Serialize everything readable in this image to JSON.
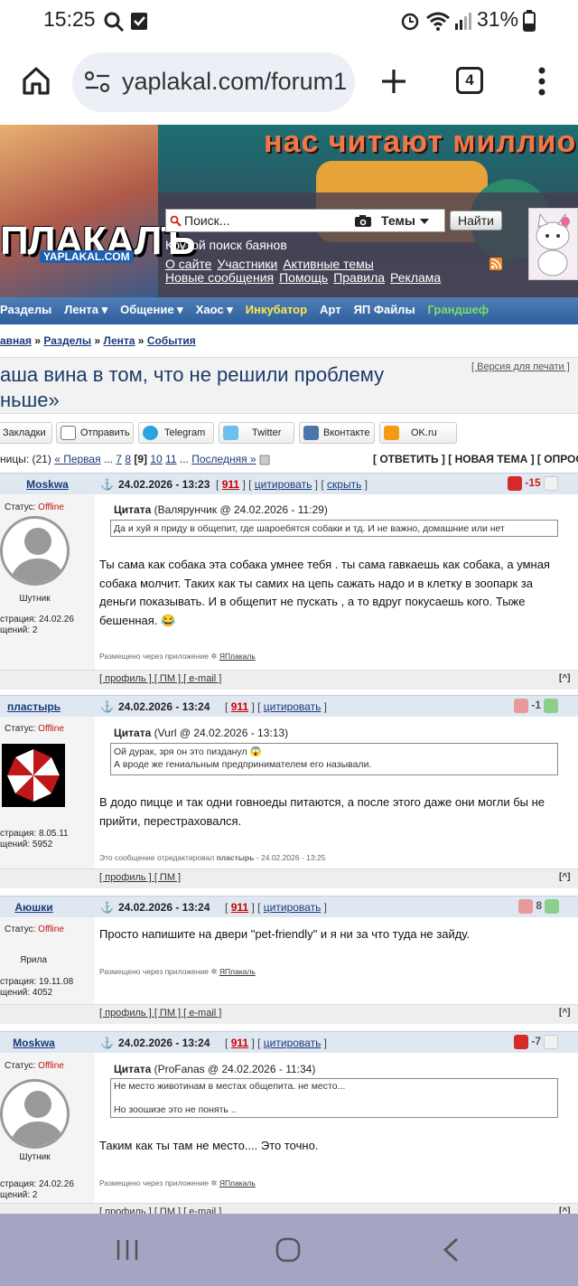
{
  "status": {
    "time": "15:25",
    "battery": "31%"
  },
  "browser": {
    "url": "yaplakal.com/forum1",
    "tab_count": "4"
  },
  "banner": {
    "slogan": "нас читают миллионы",
    "logo": "ПЛАКАЛЪ",
    "logo_sub": "YAPLAKAL.COM",
    "search_placeholder": "Поиск...",
    "search_scope": "Темы",
    "search_button": "Найти",
    "tagline": "Крутой поиск баянов",
    "links_row1": [
      "О сайте",
      "Участники",
      "Активные темы"
    ],
    "links_row2": [
      "Новые сообщения",
      "Помощь",
      "Правила",
      "Реклама"
    ]
  },
  "nav": [
    {
      "label": "Разделы",
      "color": "#ffffff"
    },
    {
      "label": "Лента ▾",
      "color": "#ffffff"
    },
    {
      "label": "Общение ▾",
      "color": "#ffffff"
    },
    {
      "label": "Хаос ▾",
      "color": "#ffffff"
    },
    {
      "label": "Инкубатор",
      "color": "#ffe64a"
    },
    {
      "label": "Арт",
      "color": "#ffffff"
    },
    {
      "label": "ЯП Файлы",
      "color": "#ffffff"
    },
    {
      "label": "Грандшеф",
      "color": "#7ddc6a"
    }
  ],
  "breadcrumb": {
    "home": "авная",
    "sep": "»",
    "sections": "Разделы",
    "feed": "Лента",
    "events": "События"
  },
  "topic": {
    "title_line1": "аша вина в том, что не решили проблему",
    "title_line2": "ньше»",
    "print_version": "[ Версия для печати ]"
  },
  "share": {
    "bookmarks": "Закладки",
    "send": "Отправить",
    "telegram": "Telegram",
    "twitter": "Twitter",
    "vk": "Вконтакте",
    "ok": "OK.ru"
  },
  "pagination": {
    "prefix": "ницы: (21)",
    "first": "« Первая",
    "dots1": "...",
    "p7": "7",
    "p8": "8",
    "current": "[9]",
    "p10": "10",
    "p11": "11",
    "dots2": "...",
    "last": "Последняя »",
    "actions": "[ ОТВЕТИТЬ ] [ НОВАЯ ТЕМА ] [ ОПРОС ]"
  },
  "posts": [
    {
      "author": "Moskwa",
      "date": "24.02.2026 - 13:23",
      "num": "911",
      "cite": "цитировать",
      "hide": "скрыть",
      "rating": "-15",
      "status_label": "Статус:",
      "status": "Offline",
      "rank": "Шутник",
      "reg": "страция: 24.02.26",
      "msgs": "щений: 2",
      "quote_head": "Цитата",
      "quote_src": "(Валярунчик @ 24.02.2026 - 11:29)",
      "quote_lines": [
        "Да и хуй я приду в общепит, где шароебятся собаки и тд. И не важно, домашние или нет"
      ],
      "text": "Ты сама как собака эта собака умнее тебя . ты сама гавкаешь как собака, а умная собака молчит. Таких как ты самих на цепь сажать надо и в клетку в зоопарк за деньги показывать. И в общепит не пускать , а то вдруг покусаешь кого. Тыже бешенная. 😂",
      "via": "Размещено через приложение",
      "app": "ЯПлакаль",
      "footer": "[ профиль ] [ ПМ ] [ e-mail ]"
    },
    {
      "author": "пластырь",
      "date": "24.02.2026 - 13:24",
      "num": "911",
      "cite": "цитировать",
      "rating": "-1",
      "status_label": "Статус:",
      "status": "Offline",
      "reg": "страция: 8.05.11",
      "msgs": "щений: 5952",
      "quote_head": "Цитата",
      "quote_src": "(Vurl @ 24.02.2026 - 13:13)",
      "quote_lines": [
        "Ой дурак, зря он это пизданул 😱",
        "А вроде же гениальным предпринимателем его называли."
      ],
      "text": "В додо пицце и так одни говноеды питаются, а после этого даже они могли бы не прийти, перестраховался.",
      "edited": "Это сообщение отредактировал",
      "edited_by": "пластырь",
      "edited_date": "- 24.02.2026 - 13:25",
      "footer": "[ профиль ] [ ПМ ]"
    },
    {
      "author": "Аюшки",
      "date": "24.02.2026 - 13:24",
      "num": "911",
      "cite": "цитировать",
      "rating": "8",
      "status_label": "Статус:",
      "status": "Offline",
      "rank": "Ярила",
      "reg": "страция: 19.11.08",
      "msgs": "щений: 4052",
      "text": "Просто напишите на двери \"pet-friendly\" и я ни за что туда не зайду.",
      "via": "Размещено через приложение",
      "app": "ЯПлакаль",
      "footer": "[ профиль ] [ ПМ ] [ e-mail ]"
    },
    {
      "author": "Moskwa",
      "date": "24.02.2026 - 13:24",
      "num": "911",
      "cite": "цитировать",
      "rating": "-7",
      "status_label": "Статус:",
      "status": "Offline",
      "rank": "Шутник",
      "reg": "страция: 24.02.26",
      "msgs": "щений: 2",
      "quote_head": "Цитата",
      "quote_src": "(ProFanas @ 24.02.2026 - 11:34)",
      "quote_lines": [
        "Не место животинам в местах общепита. не место...",
        "",
        "Но зоошизе это не понять .."
      ],
      "text": "Таким как ты там не место.... Это точно.",
      "via": "Размещено через приложение",
      "app": "ЯПлакаль",
      "footer": "[ профиль ] [ ПМ ] [ e-mail ]"
    }
  ],
  "colors": {
    "offline": "#c81010",
    "nav_bg": "#3a6aa8",
    "link": "#1a3a7a",
    "rating_neg": "#c81e1e",
    "rating_pos": "#3a9a3a"
  }
}
